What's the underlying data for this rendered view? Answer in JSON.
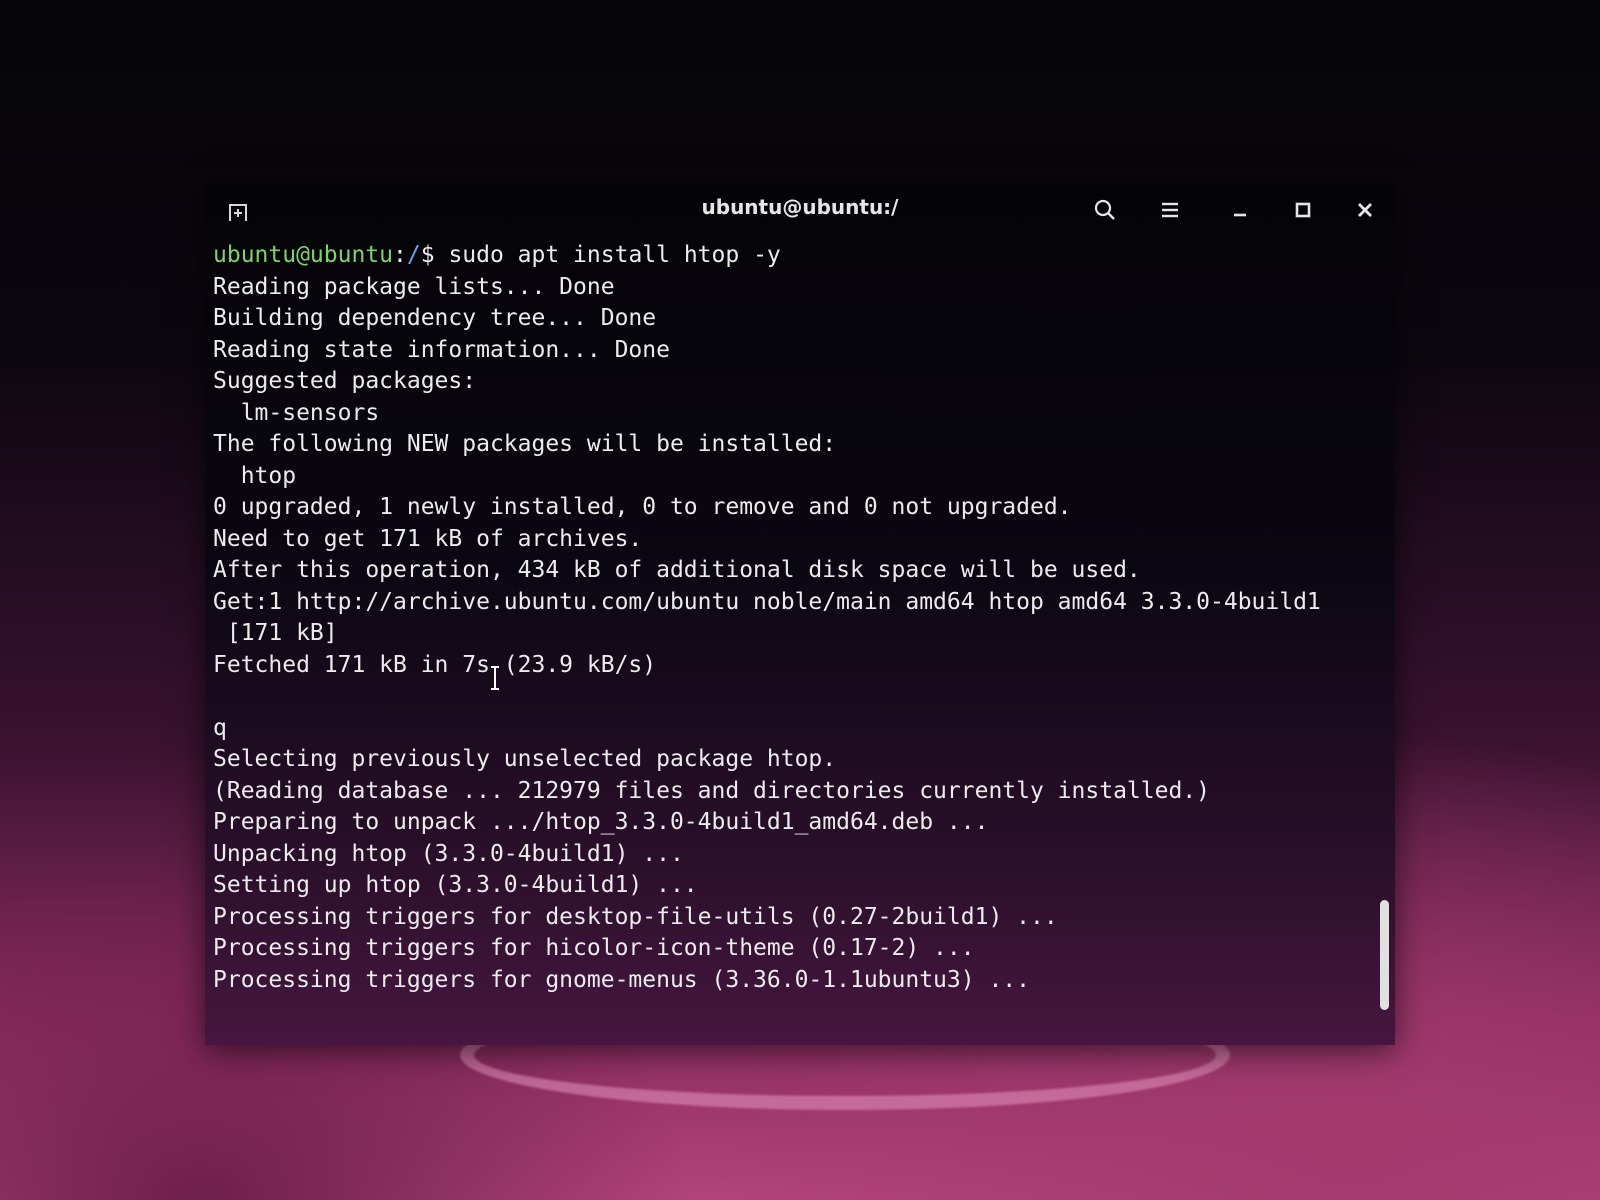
{
  "window": {
    "title": "ubuntu@ubuntu:/"
  },
  "icons": {
    "new_tab": "new-tab-icon",
    "search": "search-icon",
    "menu": "hamburger-menu-icon",
    "minimize": "minimize-icon",
    "maximize": "maximize-icon",
    "close": "close-icon",
    "cursor": "i-beam-cursor-icon"
  },
  "colors": {
    "prompt_user": "#7fd36a",
    "prompt_path": "#6f9fe6",
    "text": "#ececec"
  },
  "terminal": {
    "prompt_user": "ubuntu@ubuntu",
    "prompt_sep": ":",
    "prompt_path": "/",
    "prompt_symbol": "$ ",
    "command": "sudo apt install htop -y",
    "lines": [
      "Reading package lists... Done",
      "Building dependency tree... Done",
      "Reading state information... Done",
      "Suggested packages:",
      "  lm-sensors",
      "The following NEW packages will be installed:",
      "  htop",
      "0 upgraded, 1 newly installed, 0 to remove and 0 not upgraded.",
      "Need to get 171 kB of archives.",
      "After this operation, 434 kB of additional disk space will be used.",
      "Get:1 http://archive.ubuntu.com/ubuntu noble/main amd64 htop amd64 3.3.0-4build1",
      " [171 kB]",
      "Fetched 171 kB in 7s (23.9 kB/s)",
      "",
      "q",
      "Selecting previously unselected package htop.",
      "(Reading database ... 212979 files and directories currently installed.)",
      "Preparing to unpack .../htop_3.3.0-4build1_amd64.deb ...",
      "Unpacking htop (3.3.0-4build1) ...",
      "Setting up htop (3.3.0-4build1) ...",
      "Processing triggers for desktop-file-utils (0.27-2build1) ...",
      "Processing triggers for hicolor-icon-theme (0.17-2) ...",
      "Processing triggers for gnome-menus (3.36.0-1.1ubuntu3) ..."
    ]
  }
}
